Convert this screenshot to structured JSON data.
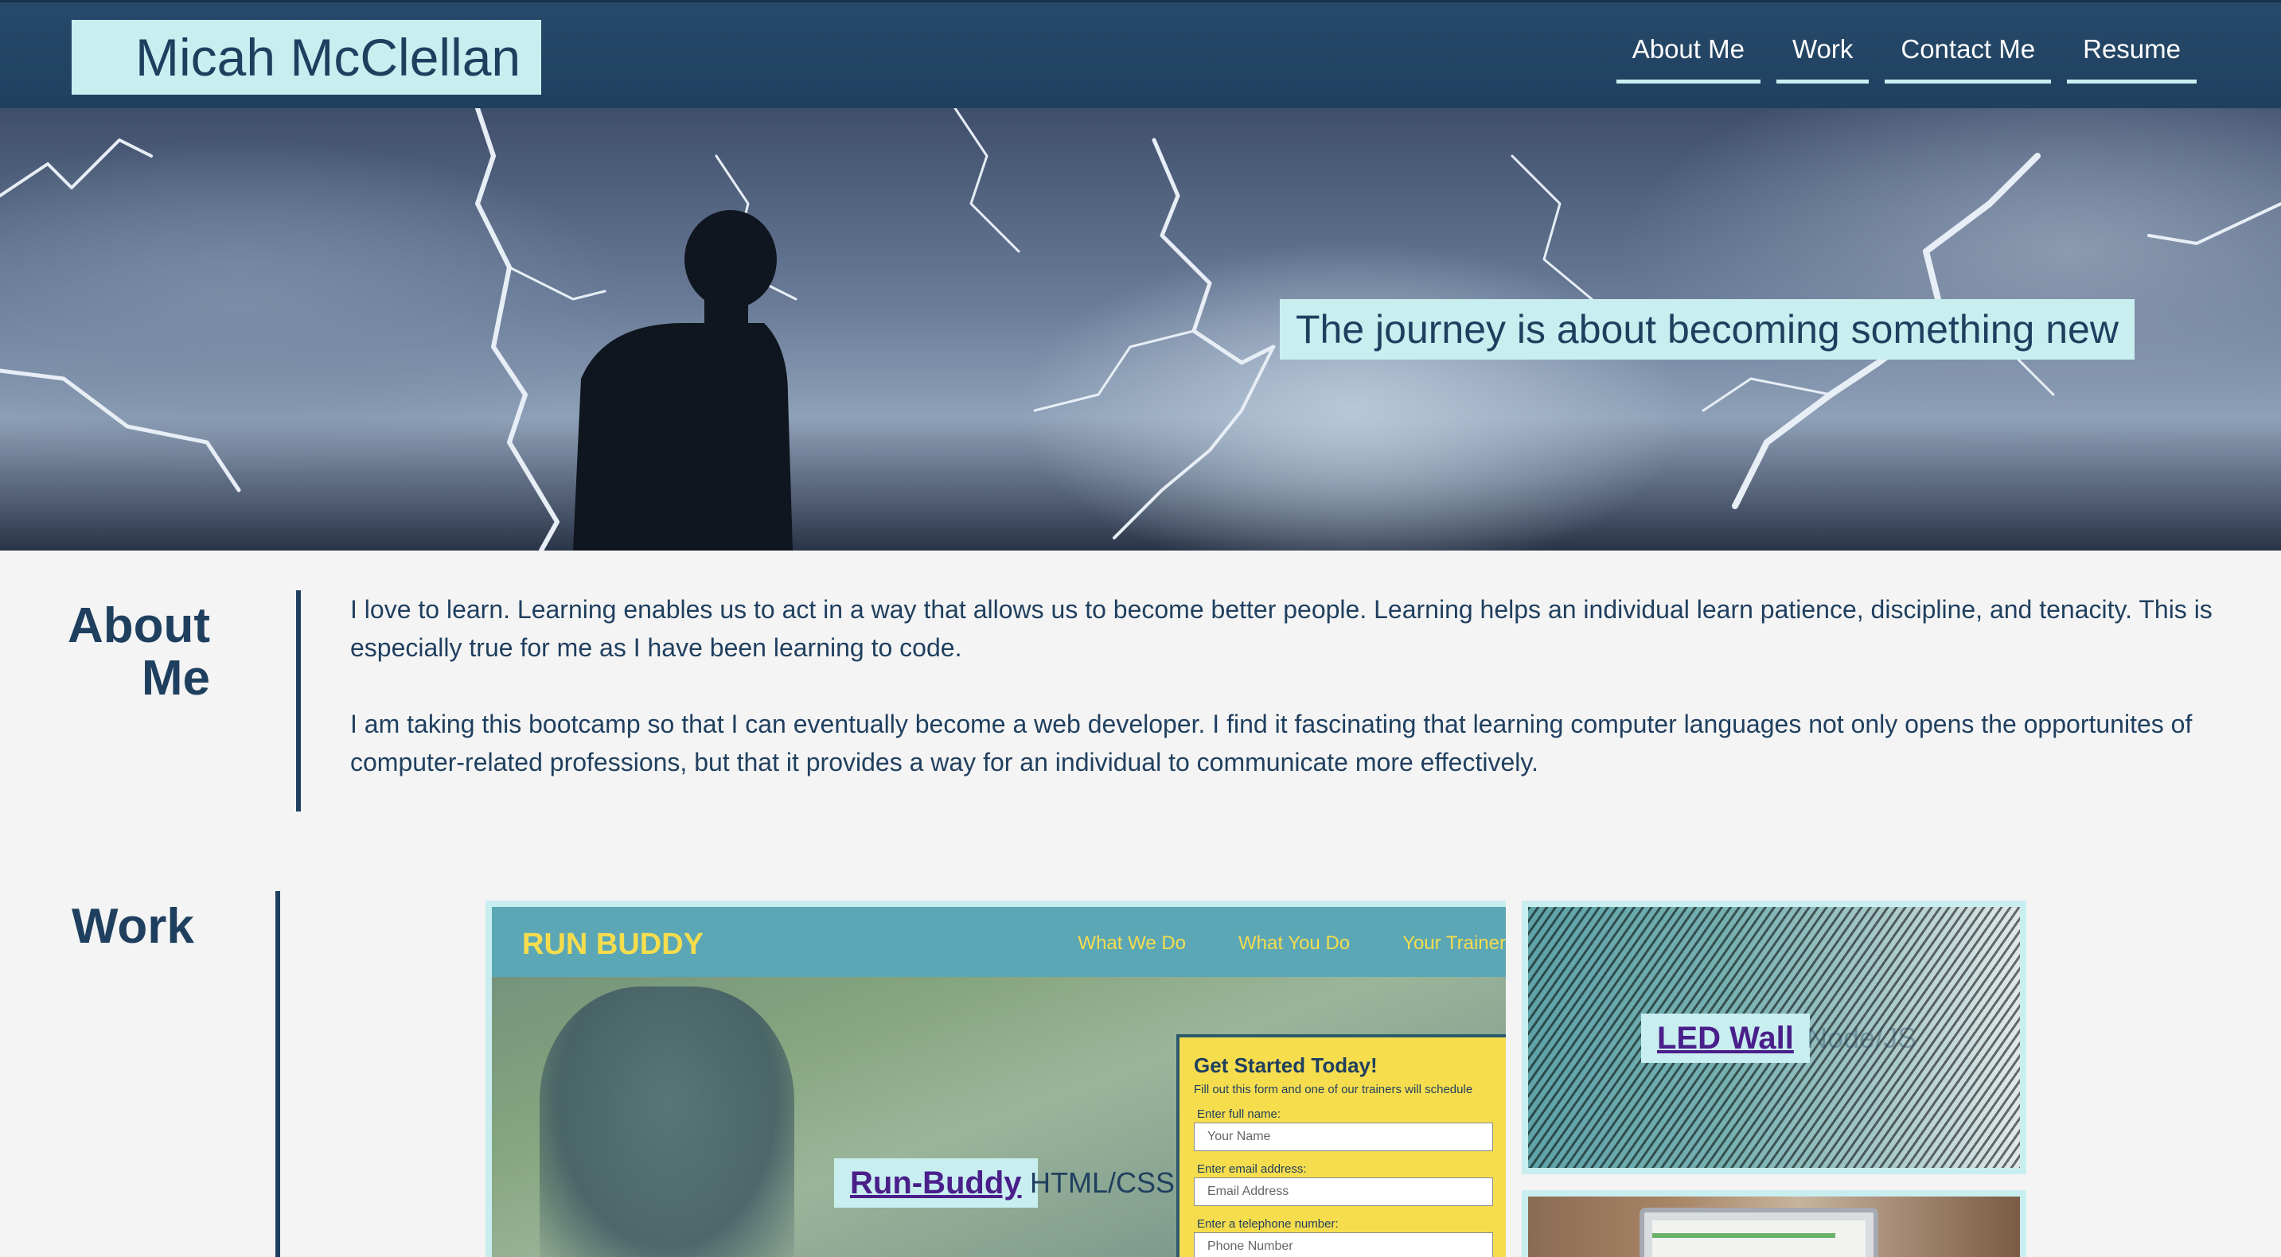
{
  "header": {
    "brand": "Micah McClellan",
    "nav": [
      {
        "label": "About Me"
      },
      {
        "label": "Work"
      },
      {
        "label": "Contact Me"
      },
      {
        "label": "Resume"
      }
    ]
  },
  "hero": {
    "tagline": "The journey is about becoming something new"
  },
  "about": {
    "title_line1": "About",
    "title_line2": "Me",
    "paragraph1": "I love to learn. Learning enables us to act in a way that allows us to become better people. Learning helps an individual learn patience, discipline, and tenacity. This is especially true for me as I have been learning to code.",
    "paragraph2": "I am taking this bootcamp so that I can eventually become a web developer. I find it fascinating that learning computer languages not only opens the opportunites of computer-related professions, but that it provides a way for an individual to communicate more effectively."
  },
  "work": {
    "title": "Work",
    "projects": [
      {
        "label": "Run-Buddy",
        "subtitle": "HTML/CSS",
        "screenshot": {
          "logo": "RUN BUDDY",
          "nav": [
            "What We Do",
            "What You Do",
            "Your Trainer"
          ],
          "form_title": "Get Started Today!",
          "form_subtitle": "Fill out this form and one of our trainers will schedule",
          "fields": [
            {
              "label": "Enter full name:",
              "placeholder": "Your Name"
            },
            {
              "label": "Enter email address:",
              "placeholder": "Email Address"
            },
            {
              "label": "Enter a telephone number:",
              "placeholder": "Phone Number"
            }
          ]
        }
      },
      {
        "label": "LED Wall",
        "subtitle": "Node/JS"
      }
    ]
  },
  "colors": {
    "header_bg": "#234566",
    "accent": "#c9eef0",
    "text_dark": "#1f3f5f",
    "link": "#4a1f8a"
  }
}
